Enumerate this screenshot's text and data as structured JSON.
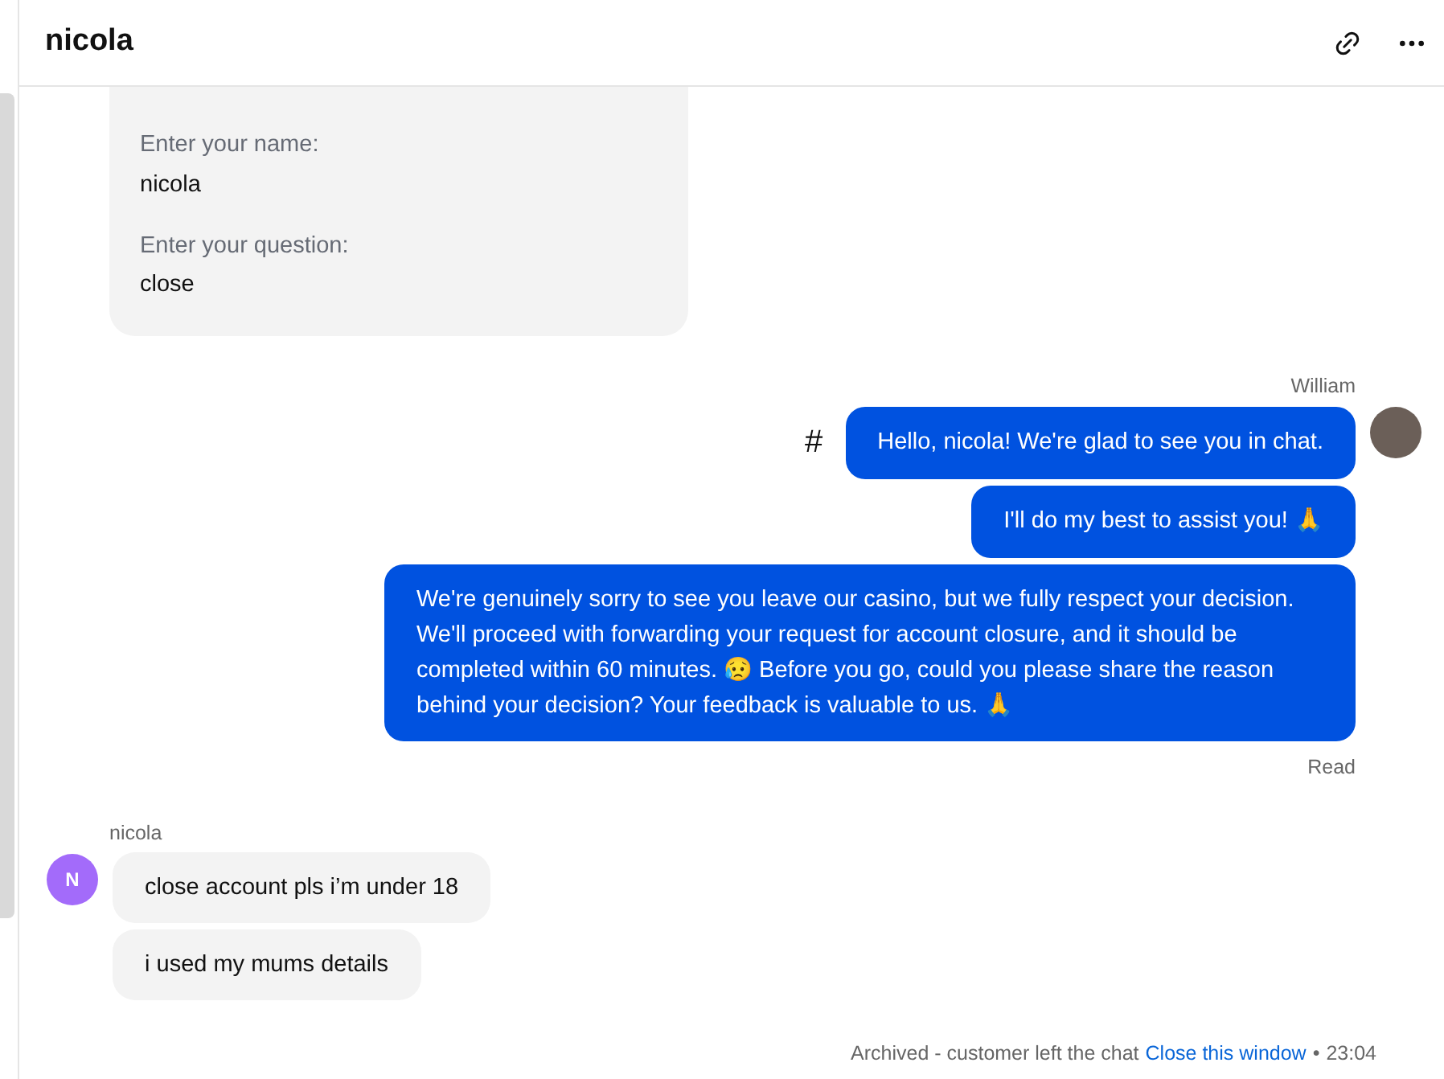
{
  "header": {
    "title": "nicola"
  },
  "prechat_form": {
    "fields": [
      {
        "label": "Enter your name:",
        "value": "nicola"
      },
      {
        "label": "Enter your question:",
        "value": "close"
      }
    ]
  },
  "agent": {
    "name": "William",
    "marker": "#",
    "messages": [
      "Hello, nicola! We're glad to see you in chat.",
      "I'll do my best to assist you! 🙏",
      "We're genuinely sorry to see you leave our casino, but we fully respect your decision. We'll proceed with forwarding your request for account closure, and it should be completed within 60 minutes. 😥 Before you go, could you please share the reason behind your decision? Your feedback is valuable to us. 🙏"
    ],
    "status": "Read"
  },
  "customer": {
    "name": "nicola",
    "initial": "N",
    "messages": [
      "close account pls i’m under 18",
      "i used my mums details"
    ]
  },
  "footer": {
    "status": "Archived - customer left the chat",
    "link": "Close this window",
    "separator": "•",
    "time": "23:04"
  }
}
